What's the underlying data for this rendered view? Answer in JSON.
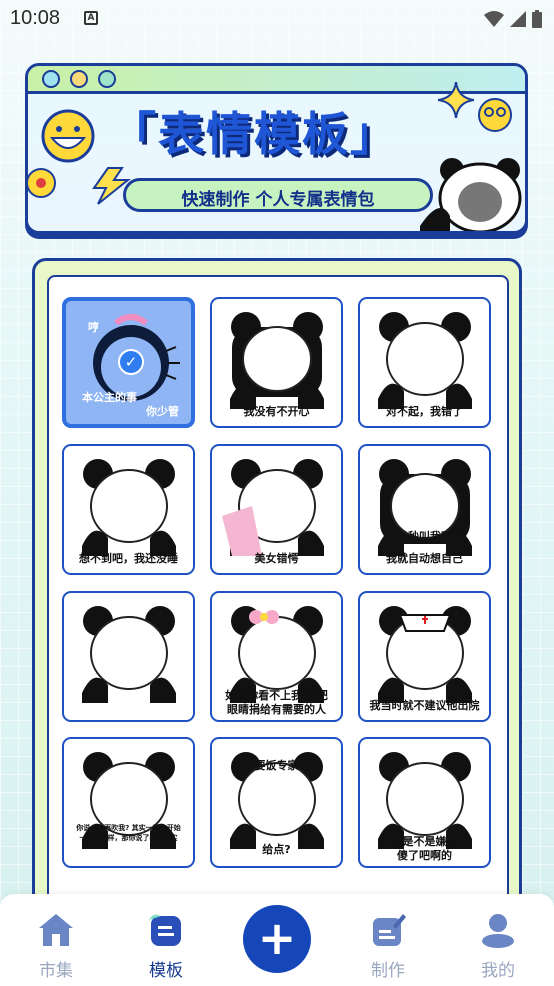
{
  "status_bar": {
    "time": "10:08",
    "app_icon_letter": "A"
  },
  "banner": {
    "title": "「表情模板」",
    "subtitle": "快速制作 个人专属表情包",
    "dot_colors": [
      "#9fe3f0",
      "#f7d97a",
      "#9fe3c8"
    ]
  },
  "templates": [
    {
      "caption_top": "哼",
      "caption": "本公主的事",
      "caption_extra": "你少管",
      "selected": true
    },
    {
      "caption": "我没有不开心",
      "selected": false
    },
    {
      "caption": "对不起，我错了",
      "selected": false
    },
    {
      "caption": "想不到吧，我还没睡",
      "selected": false
    },
    {
      "caption": "美女错愕",
      "selected": false
    },
    {
      "caption_top": "下一秒叫我再学",
      "caption": "我就自动想自己",
      "selected": false
    },
    {
      "caption": "",
      "selected": false
    },
    {
      "caption": "如果你看不上我 请把",
      "caption_extra": "眼睛捐给有需要的人",
      "selected": false
    },
    {
      "caption": "我当时就不建议他出院",
      "selected": false
    },
    {
      "caption": "你说一你再吹我? 其实一我一开始",
      "caption_extra": "一我也一样，那你说了吧，其实",
      "selected": false
    },
    {
      "caption_top": "要饭专家",
      "caption": "给点?",
      "selected": false
    },
    {
      "caption": "你是不是嫌我",
      "caption_extra": "傻了吧啊的",
      "selected": false
    }
  ],
  "bottom_nav": {
    "items": [
      {
        "label": "市集",
        "icon": "home-icon",
        "active": false
      },
      {
        "label": "模板",
        "icon": "template-icon",
        "active": true
      },
      {
        "label": "制作",
        "icon": "edit-icon",
        "active": false
      },
      {
        "label": "我的",
        "icon": "profile-icon",
        "active": false
      }
    ],
    "fab_symbol": "+"
  },
  "colors": {
    "accent": "#1547b8",
    "card_border": "#1e52c4",
    "selected_bg": "#8fb5f4",
    "nav_inactive": "#9aa6c0",
    "nav_active": "#1a3b8f"
  }
}
